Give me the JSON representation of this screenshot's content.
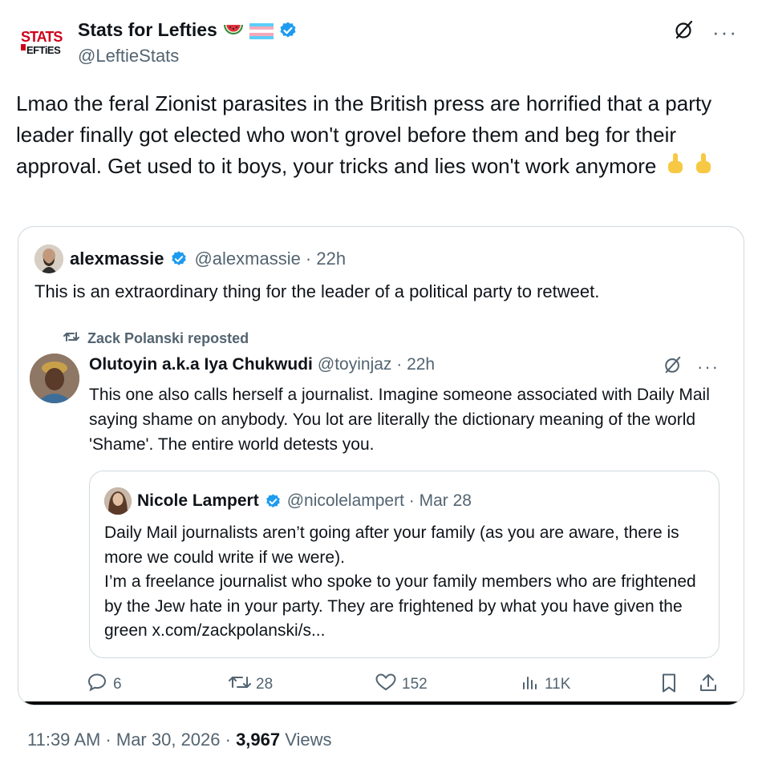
{
  "author": {
    "display_name": "Stats for Lefties",
    "handle": "@LeftieStats",
    "logo_text_top": "STATS",
    "logo_text_bottom": "LEFTIES",
    "emojis": [
      "watermelon",
      "trans-flag"
    ],
    "verified": true
  },
  "post": {
    "text": "Lmao the feral Zionist parasites in the British press are horrified that a party leader finally got elected who won't grovel before them and beg for their approval. Get used to it boys, your tricks and lies won't work anymore"
  },
  "quote": {
    "display_name": "alexmassie",
    "handle_time": "@alexmassie · 22h",
    "text": "This is an extraordinary thing for the leader of a political party to retweet.",
    "repost_label": "Zack Polanski reposted",
    "repost": {
      "display_name": "Olutoyin a.k.a Iya Chukwudi",
      "handle_time": "@toyinjaz · 22h",
      "text": "This one also calls herself a journalist. Imagine someone associated with Daily Mail saying shame on anybody. You lot are literally the dictionary meaning of the world 'Shame'. The entire world detests you.",
      "inner": {
        "display_name": "Nicole Lampert",
        "handle_time": "@nicolelampert · Mar 28",
        "line1": "Daily Mail journalists aren’t going after your family (as you are aware, there is more we could write if we were).",
        "line2": "I’m a freelance journalist who spoke to your family members who are frightened by the Jew hate in your party. They are frightened by what you have given the green x.com/zackpolanski/s..."
      }
    },
    "actions": {
      "replies": "6",
      "reposts": "28",
      "likes": "152",
      "views": "11K"
    }
  },
  "meta": {
    "time": "11:39 AM · Mar 30, 2026 · ",
    "views_count": "3,967",
    "views_label": " Views"
  },
  "colors": {
    "text": "#0f1419",
    "muted": "#536471",
    "verified": "#1d9bf0",
    "border": "#cfd9de",
    "logo_red": "#d0021b"
  }
}
